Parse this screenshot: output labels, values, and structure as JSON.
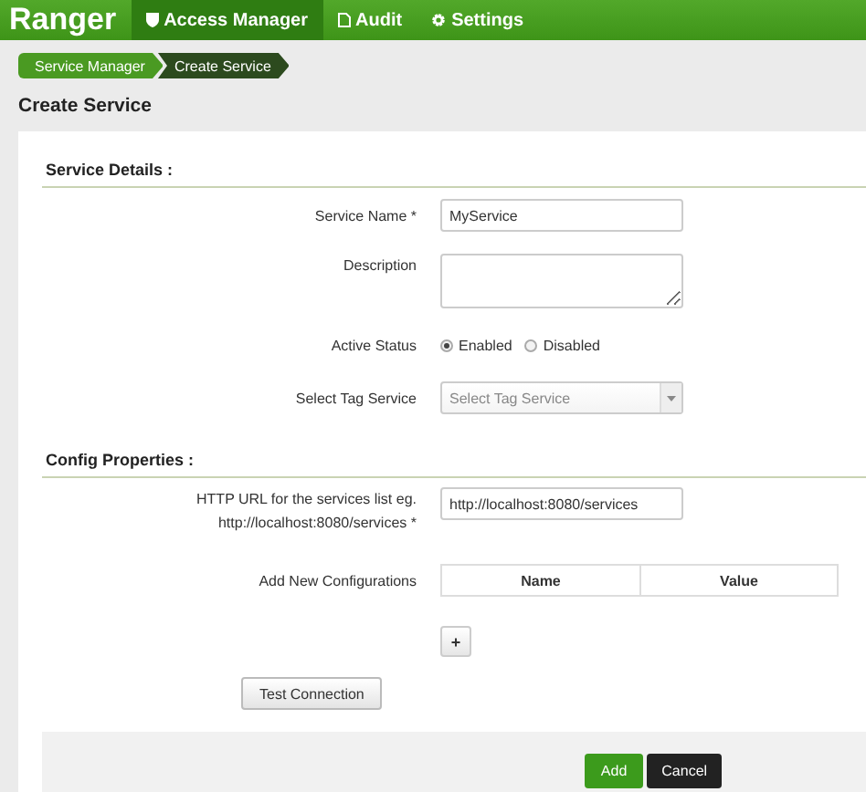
{
  "brand": "Ranger",
  "nav": [
    {
      "label": "Access Manager",
      "selected": true
    },
    {
      "label": "Audit",
      "selected": false
    },
    {
      "label": "Settings",
      "selected": false
    }
  ],
  "breadcrumb": [
    "Service Manager",
    "Create Service"
  ],
  "page_title": "Create Service",
  "service_details": {
    "heading": "Service Details :",
    "service_name": {
      "label": "Service Name *",
      "value": "MyService"
    },
    "description": {
      "label": "Description"
    },
    "active_status": {
      "label": "Active Status",
      "options": [
        {
          "label": "Enabled",
          "selected": true
        },
        {
          "label": "Disabled",
          "selected": false
        }
      ]
    },
    "tag_service": {
      "label": "Select Tag Service",
      "placeholder": "Select Tag Service"
    }
  },
  "config_properties": {
    "heading": "Config Properties :",
    "url": {
      "label_lines": [
        "HTTP URL for the services list eg.",
        "http://localhost:8080/services *"
      ],
      "value": "http://localhost:8080/services"
    },
    "new_configurations": {
      "label": "Add New Configurations",
      "columns": [
        "Name",
        "Value"
      ],
      "add_button": "+"
    },
    "test_button": "Test Connection"
  },
  "footer_buttons": [
    {
      "label": "Add",
      "kind": "primary"
    },
    {
      "label": "Cancel",
      "kind": "dark"
    }
  ]
}
